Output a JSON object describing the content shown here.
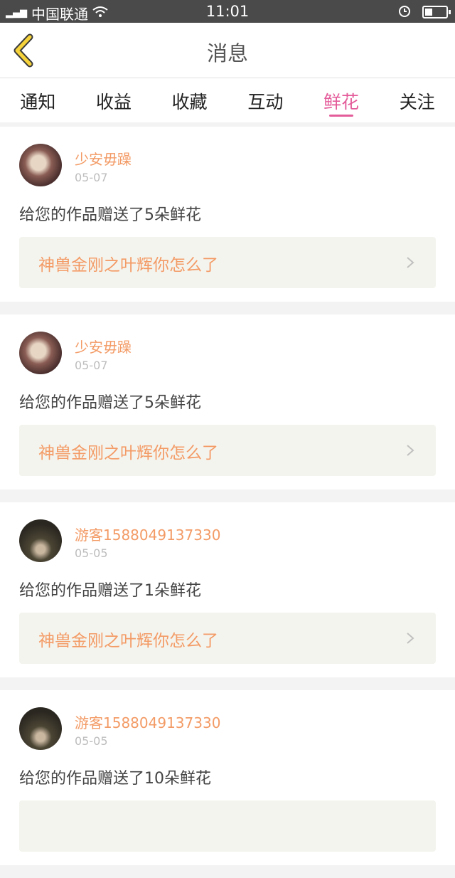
{
  "statusbar": {
    "carrier": "中国联通",
    "network": "4G",
    "time": "11:01",
    "battery_level": 0.35
  },
  "header": {
    "title": "消息"
  },
  "tabs": [
    "通知",
    "收益",
    "收藏",
    "互动",
    "鲜花",
    "关注"
  ],
  "active_tab": "鲜花",
  "messages": [
    {
      "user": "少安毋躁",
      "date": "05-07",
      "text": "给您的作品赠送了5朵鲜花",
      "work": "神兽金刚之叶辉你怎么了"
    },
    {
      "user": "少安毋躁",
      "date": "05-07",
      "text": "给您的作品赠送了5朵鲜花",
      "work": "神兽金刚之叶辉你怎么了"
    },
    {
      "user": "游客1588049137330",
      "date": "05-05",
      "text": "给您的作品赠送了1朵鲜花",
      "work": "神兽金刚之叶辉你怎么了"
    },
    {
      "user": "游客1588049137330",
      "date": "05-05",
      "text": "给您的作品赠送了10朵鲜花",
      "work": ""
    }
  ],
  "colors": {
    "accent": "#e45c9a",
    "name": "#f39b66",
    "back_icon": "#f6d33a"
  }
}
